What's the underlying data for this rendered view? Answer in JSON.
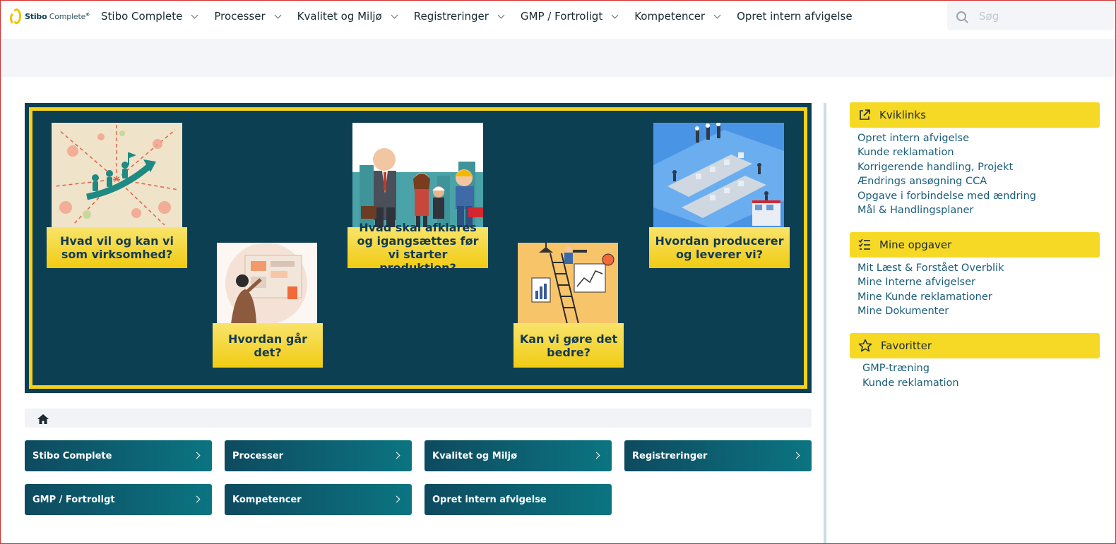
{
  "logo": {
    "brand": "Stibo",
    "product": " Complete",
    "reg": "®"
  },
  "nav": {
    "items": [
      {
        "label": "Stibo Complete",
        "dropdown": true
      },
      {
        "label": "Processer",
        "dropdown": true
      },
      {
        "label": "Kvalitet og Miljø",
        "dropdown": true
      },
      {
        "label": "Registreringer",
        "dropdown": true
      },
      {
        "label": "GMP / Fortroligt",
        "dropdown": true
      },
      {
        "label": "Kompetencer",
        "dropdown": true
      },
      {
        "label": "Opret intern afvigelse",
        "dropdown": false
      }
    ]
  },
  "search": {
    "placeholder": "Søg",
    "value": ""
  },
  "banner": {
    "tiles": [
      {
        "label": "Hvad vil og kan vi som virksomhed?"
      },
      {
        "label": "Hvordan går det?"
      },
      {
        "label": "Hvad skal afklares og igangsættes før vi starter produktion?"
      },
      {
        "label": "Kan vi gøre det bedre?"
      },
      {
        "label": "Hvordan producerer og leverer vi?"
      }
    ]
  },
  "tiles": [
    {
      "label": "Stibo Complete"
    },
    {
      "label": "Processer"
    },
    {
      "label": "Kvalitet og Miljø"
    },
    {
      "label": "Registreringer"
    },
    {
      "label": "GMP / Fortroligt"
    },
    {
      "label": "Kompetencer"
    },
    {
      "label": "Opret intern afvigelse"
    }
  ],
  "sidebar": {
    "kviklinks": {
      "title": "Kviklinks",
      "links": [
        "Opret intern afvigelse",
        "Kunde reklamation",
        "Korrigerende handling, Projekt",
        "Ændrings ansøgning CCA",
        "Opgave i forbindelse med ændring",
        "Mål & Handlingsplaner"
      ]
    },
    "opgaver": {
      "title": "Mine opgaver",
      "links": [
        "Mit Læst & Forstået Overblik",
        "Mine Interne afvigelser",
        "Mine Kunde reklamationer",
        "Mine Dokumenter"
      ]
    },
    "favoritter": {
      "title": "Favoritter",
      "links": [
        "GMP-træning",
        "Kunde reklamation"
      ]
    }
  },
  "colors": {
    "accent": "#f6d924",
    "dark_teal": "#0d3f52",
    "teal": "#0b7581",
    "link": "#1a5d7a"
  }
}
